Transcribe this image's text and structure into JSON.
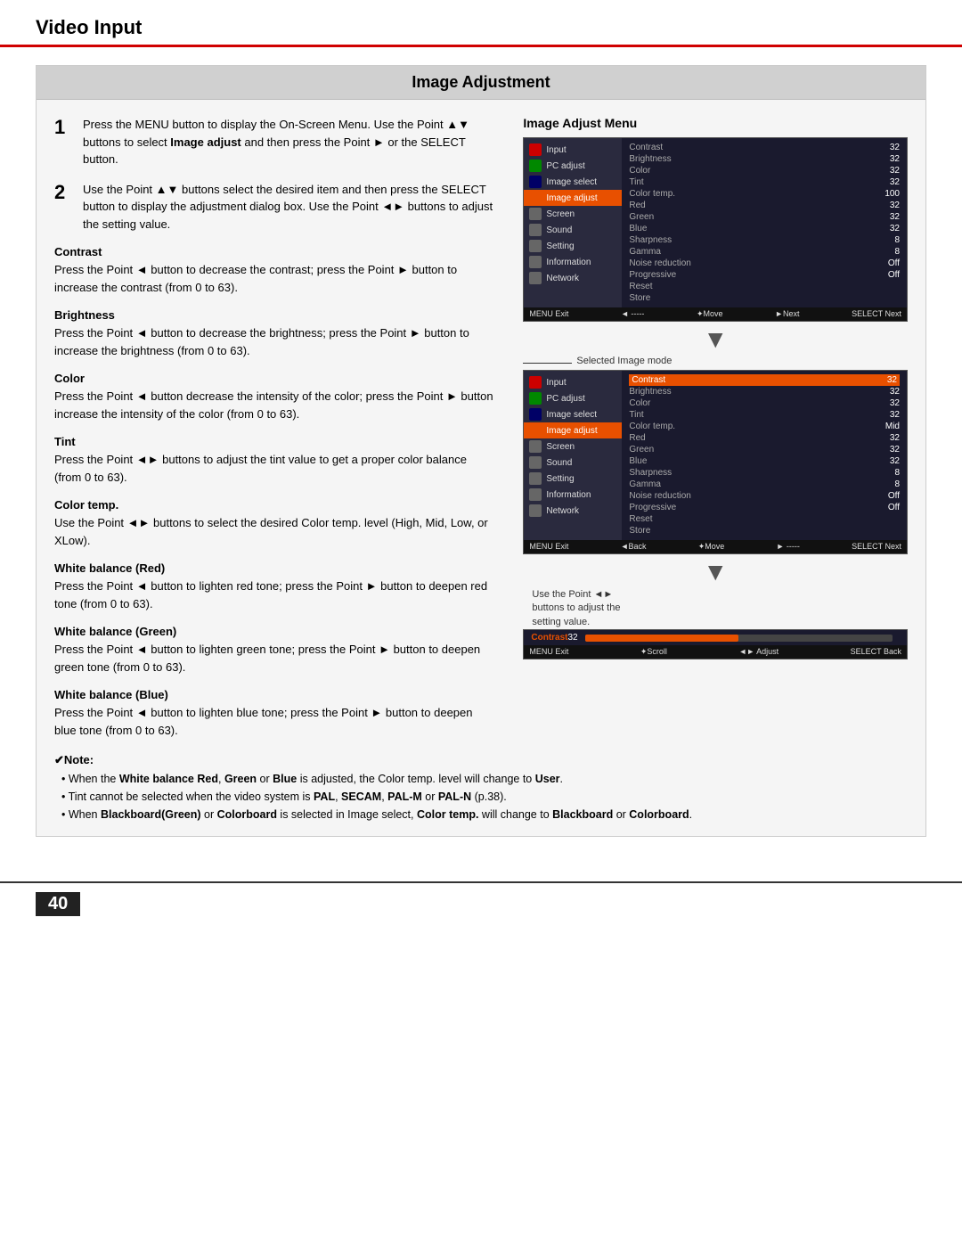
{
  "header": {
    "title": "Video Input"
  },
  "section": {
    "title": "Image Adjustment"
  },
  "steps": [
    {
      "num": "1",
      "text": "Press the MENU button to display the On-Screen Menu. Use the Point ▲▼ buttons to select ",
      "bold1": "Image adjust",
      "text2": " and then press the Point ► or the SELECT button."
    },
    {
      "num": "2",
      "text": "Use the Point ▲▼ buttons select the desired item and then press the SELECT button to display the adjustment dialog box. Use the Point ◄► buttons to adjust the setting value."
    }
  ],
  "subsections": [
    {
      "heading": "Contrast",
      "text": "Press the Point ◄ button to decrease the contrast; press the Point ► button to increase the contrast (from 0 to 63)."
    },
    {
      "heading": "Brightness",
      "text": "Press the Point ◄ button to decrease the brightness; press the Point ► button to increase the brightness (from 0 to 63)."
    },
    {
      "heading": "Color",
      "text": "Press the Point ◄ button decrease the intensity of the color; press the Point ► button increase the intensity of the color (from 0 to 63)."
    },
    {
      "heading": "Tint",
      "text": "Press the Point ◄► buttons to adjust the tint value to get a proper color balance (from 0 to 63)."
    },
    {
      "heading": "Color temp.",
      "text": "Use the Point ◄► buttons to select the desired Color temp. level (High, Mid, Low, or XLow)."
    },
    {
      "heading": "White balance (Red)",
      "text": "Press the Point ◄ button to lighten red tone; press the Point ► button to deepen red tone (from 0 to 63)."
    },
    {
      "heading": "White balance (Green)",
      "text": "Press the Point ◄ button to lighten green tone; press the Point ► button to deepen green tone (from 0 to 63)."
    },
    {
      "heading": "White balance (Blue)",
      "text": "Press the Point ◄ button to lighten blue tone; press the Point ► button to deepen blue tone (from 0 to 63)."
    }
  ],
  "right_col": {
    "title": "Image Adjust Menu",
    "selected_image_mode_label": "Selected Image mode",
    "use_point_text": "Use the Point ◄► buttons to adjust the setting value.",
    "menu1": {
      "items_left": [
        "Input",
        "PC adjust",
        "Image select",
        "Image adjust",
        "Screen",
        "Sound",
        "Setting",
        "Information",
        "Network"
      ],
      "items_right": [
        "Contrast",
        "Brightness",
        "Color",
        "Tint",
        "Color temp.",
        "Red",
        "Green",
        "Blue",
        "Sharpness",
        "Gamma",
        "Noise reduction",
        "Progressive",
        "Reset",
        "Store"
      ],
      "values": [
        "32",
        "32",
        "32",
        "32",
        "100",
        "32",
        "32",
        "32",
        "8",
        "8",
        "Off",
        "Off",
        "",
        ""
      ],
      "bar": [
        "MENU Exit",
        "◄ -----",
        "✦Move",
        "►Next",
        "SELECT Next"
      ]
    },
    "menu2": {
      "items_left": [
        "Input",
        "PC adjust",
        "Image select",
        "Image adjust",
        "Screen",
        "Sound",
        "Setting",
        "Information",
        "Network"
      ],
      "items_right": [
        "Contrast",
        "Brightness",
        "Color",
        "Tint",
        "Color temp.",
        "Red",
        "Green",
        "Blue",
        "Sharpness",
        "Gamma",
        "Noise reduction",
        "Progressive",
        "Reset",
        "Store"
      ],
      "values": [
        "32",
        "32",
        "32",
        "32",
        "Mid",
        "32",
        "32",
        "32",
        "8",
        "8",
        "Off",
        "Off",
        "",
        ""
      ],
      "bar": [
        "MENU Exit",
        "◄Back",
        "✦Move",
        "► -----",
        "SELECT Next"
      ]
    },
    "slider": {
      "label": "Contrast",
      "value": "32",
      "fill_percent": 50,
      "bar": [
        "MENU Exit",
        "✦Scroll",
        "◄► Adjust",
        "SELECT Back"
      ]
    }
  },
  "note": {
    "heading": "✔Note:",
    "lines": [
      "When the White balance Red, Green or Blue is adjusted, the Color temp. level will change to User.",
      "Tint cannot be selected when the video system is PAL, SECAM, PAL-M or PAL-N (p.38).",
      "When Blackboard(Green) or Colorboard is selected in Image select, Color temp. will change to Blackboard or Colorboard."
    ]
  },
  "page_number": "40"
}
